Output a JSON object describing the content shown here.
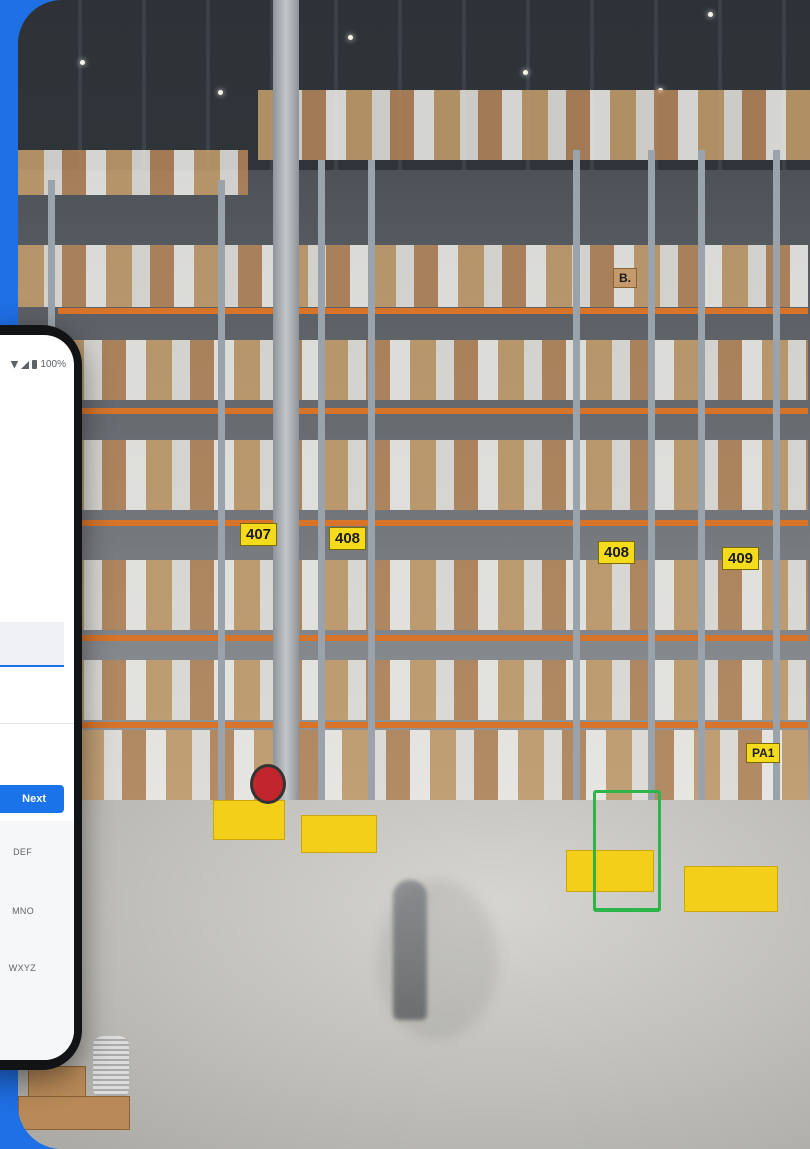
{
  "scene": {
    "aisle_signs": [
      "407",
      "408",
      "408",
      "409",
      "PA1",
      "B."
    ]
  },
  "phone": {
    "status_bar": {
      "battery": "100%"
    },
    "primary_button_label": "Next",
    "keypad": {
      "keys": [
        "DEF",
        "MNO",
        "WXYZ"
      ]
    }
  },
  "colors": {
    "background_blue": "#1f6fe5",
    "button_blue": "#1a73e8",
    "aisle_sign_yellow": "#f4dc1c"
  }
}
